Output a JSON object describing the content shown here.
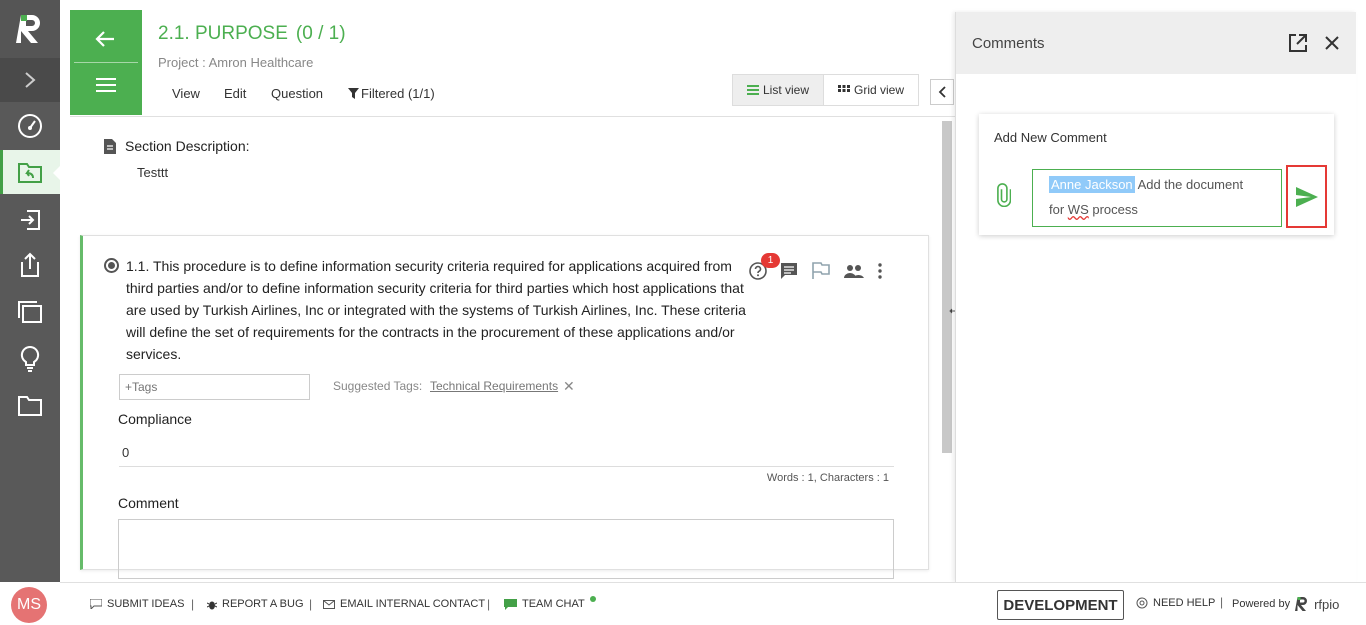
{
  "sidebar": {
    "items": [
      "dashboard",
      "projects",
      "import",
      "export",
      "library",
      "insights",
      "documents"
    ],
    "user_initials": "MS"
  },
  "header": {
    "title": "2.1. PURPOSE",
    "count": "(0 / 1)",
    "project": "Project : Amron Healthcare",
    "menu": {
      "view": "View",
      "edit": "Edit",
      "question": "Question",
      "filtered": "Filtered (1/1)"
    },
    "list_view": "List view",
    "grid_view": "Grid view"
  },
  "section": {
    "label": "Section Description:",
    "text": "Testtt"
  },
  "question": {
    "text": "1.1. This procedure is to define information security criteria required for applications acquired from third parties and/or to define information security criteria for third parties which host applications that are used by Turkish Airlines, Inc or integrated with the systems of Turkish Airlines, Inc. These criteria will define the set of requirements for the contracts in the procurement of these applications and/or services.",
    "badge": "1",
    "tags_placeholder": "+Tags",
    "suggested_label": "Suggested Tags:",
    "suggested_tag": "Technical Requirements",
    "compliance_label": "Compliance",
    "compliance_value": "0",
    "word_count": "Words : 1, Characters : 1",
    "comment_label": "Comment"
  },
  "comments": {
    "title": "Comments",
    "add_new": "Add New Comment",
    "mention": "Anne Jackson",
    "text_part1": " Add the document",
    "text_part2_pre": "for ",
    "text_part2_spell": "WS",
    "text_part2_post": " process"
  },
  "footer": {
    "submit_ideas": "SUBMIT IDEAS",
    "report_bug": "REPORT A BUG",
    "email_contact": "EMAIL INTERNAL CONTACT",
    "team_chat": "TEAM CHAT",
    "environment": "DEVELOPMENT",
    "need_help": "NEED HELP",
    "powered_by": "Powered by",
    "brand": "rfpio"
  },
  "colors": {
    "accent": "#4caf50",
    "sidebar": "#595959",
    "badge": "#e53935"
  }
}
